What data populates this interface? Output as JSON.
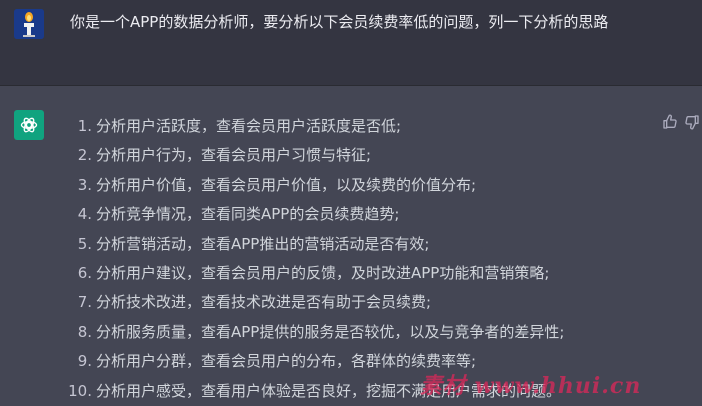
{
  "user_message": "你是一个APP的数据分析师，要分析以下会员续费率低的问题，列一下分析的思路",
  "answer_items": [
    {
      "num": "1.",
      "text": "分析用户活跃度，查看会员用户活跃度是否低;"
    },
    {
      "num": "2.",
      "text": "分析用户行为，查看会员用户习惯与特征;"
    },
    {
      "num": "3.",
      "text": "分析用户价值，查看会员用户价值，以及续费的价值分布;"
    },
    {
      "num": "4.",
      "text": "分析竞争情况，查看同类APP的会员续费趋势;"
    },
    {
      "num": "5.",
      "text": "分析营销活动，查看APP推出的营销活动是否有效;"
    },
    {
      "num": "6.",
      "text": "分析用户建议，查看会员用户的反馈，及时改进APP功能和营销策略;"
    },
    {
      "num": "7.",
      "text": "分析技术改进，查看技术改进是否有助于会员续费;"
    },
    {
      "num": "8.",
      "text": "分析服务质量，查看APP提供的服务是否较优，以及与竞争者的差异性;"
    },
    {
      "num": "9.",
      "text": "分析用户分群，查看会员用户的分布，各群体的续费率等;"
    },
    {
      "num": "10.",
      "text": "分析用户感受，查看用户体验是否良好，挖掘不满足用户需求的问题。"
    }
  ],
  "watermark": "素材 www.hhui.cn",
  "icons": {
    "user_avatar": "user-avatar-icon",
    "bot_avatar": "openai-logo-icon",
    "like": "thumbs-up-icon",
    "dislike": "thumbs-down-icon"
  },
  "colors": {
    "user_bg": "#343541",
    "answer_bg": "#444654",
    "bot_avatar": "#10a37f",
    "text": "#d1d5db"
  }
}
